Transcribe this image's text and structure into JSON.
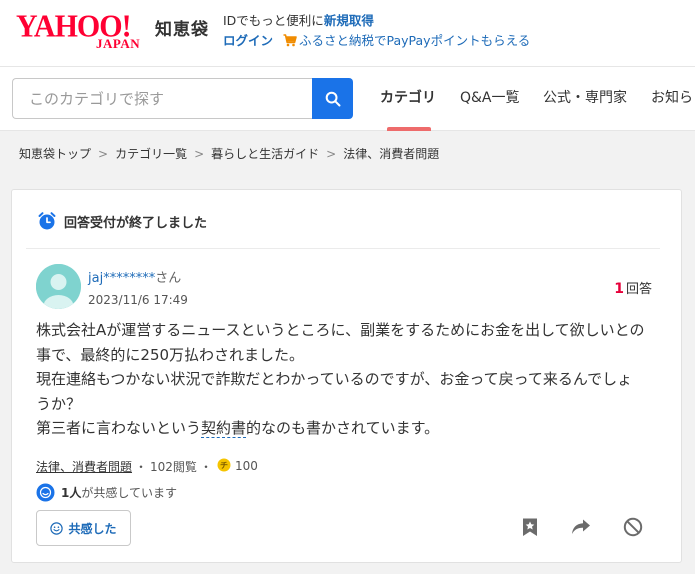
{
  "header": {
    "logo_yahoo": "YAHOO!",
    "logo_japan": "JAPAN",
    "service_name": "知恵袋",
    "promo_text": "IDでもっと便利に",
    "signup_link": "新規取得",
    "login_link": "ログイン",
    "furusato_link": "ふるさと納税でPayPayポイントもらえる"
  },
  "search": {
    "placeholder": "このカテゴリで探す"
  },
  "nav": {
    "tabs": [
      {
        "label": "カテゴリ",
        "active": true
      },
      {
        "label": "Q&A一覧",
        "active": false
      },
      {
        "label": "公式・専門家",
        "active": false
      },
      {
        "label": "お知ら",
        "active": false
      }
    ]
  },
  "breadcrumb": {
    "items": [
      "知恵袋トップ",
      "カテゴリ一覧",
      "暮らしと生活ガイド",
      "法律、消費者問題"
    ],
    "separator": ">"
  },
  "question": {
    "closed_notice": "回答受付が終了しました",
    "user_name": "jaj********",
    "honorific": "さん",
    "date": "2023/11/6 17:49",
    "answer_count": "1",
    "answer_label": "回答",
    "body_lines": [
      "株式会社Aが運営するニュースというところに、副業をするためにお金を出して欲しいとの事で、最終的に250万払わされました。",
      "現在連絡もつかない状況で詐欺だとわかっているのですが、お金って戻って来るんでしょうか？"
    ],
    "body_last_prefix": "第三者に言わないという",
    "body_last_link": "契約書",
    "body_last_suffix": "的なのも書かされています。",
    "category": "法律、消費者問題",
    "views": "102閲覧",
    "coins": "100",
    "empathy_count": "1人",
    "empathy_suffix": "が共感しています",
    "empathy_button": "共感した"
  },
  "colors": {
    "brand_red": "#ff0033",
    "link_blue": "#1e6bb8",
    "search_blue": "#1a73e8",
    "tab_underline": "#ee6b6b"
  }
}
